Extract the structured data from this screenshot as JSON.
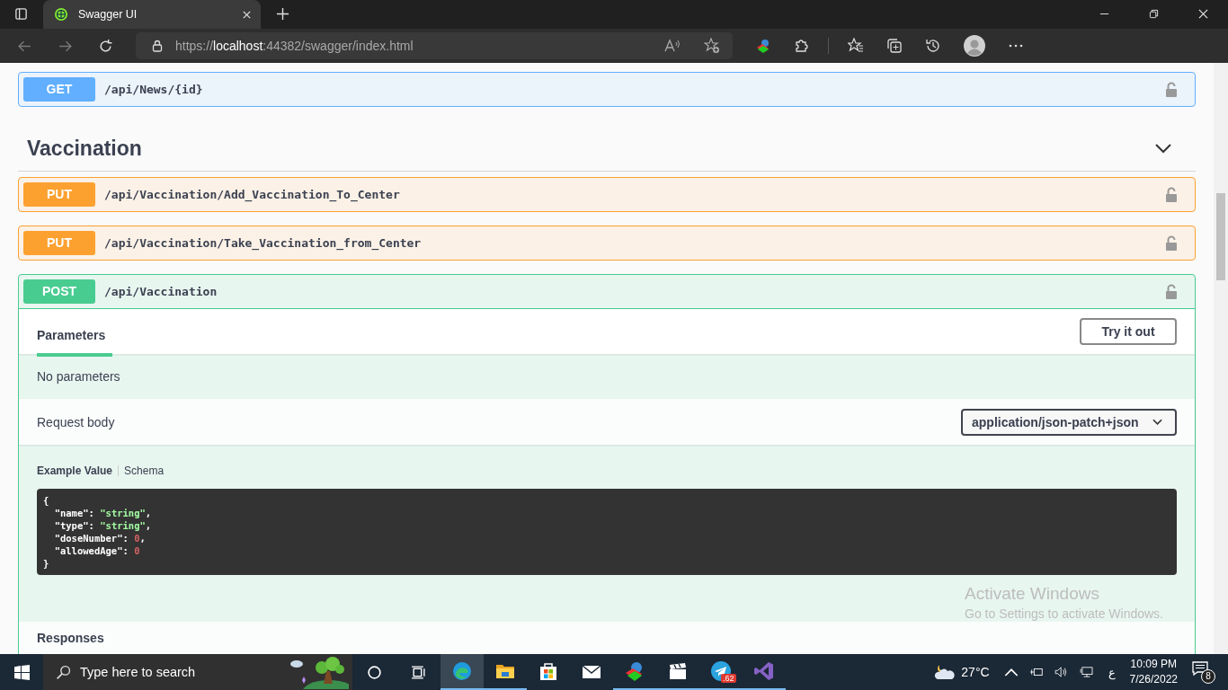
{
  "browser": {
    "tab": {
      "title": "Swagger UI",
      "selected": true
    },
    "address": {
      "scheme": "https://",
      "host": "localhost",
      "rest": ":44382/swagger/index.html"
    }
  },
  "top_operations": [
    {
      "method": "GET",
      "path": "/api/News/{id}",
      "expanded": false
    }
  ],
  "section": {
    "title": "Vaccination",
    "expanded": true
  },
  "operations": [
    {
      "method": "PUT",
      "path": "/api/Vaccination/Add_Vaccination_To_Center",
      "expanded": false
    },
    {
      "method": "PUT",
      "path": "/api/Vaccination/Take_Vaccination_from_Center",
      "expanded": false
    },
    {
      "method": "POST",
      "path": "/api/Vaccination",
      "expanded": true
    }
  ],
  "details": {
    "tab": {
      "label": "Parameters",
      "selected": true
    },
    "try_button": "Try it out",
    "no_params": "No parameters",
    "request_body_label": "Request body",
    "content_type": "application/json-patch+json",
    "example_tabs": [
      {
        "label": "Example Value",
        "selected": true
      },
      {
        "label": "Schema",
        "selected": false
      }
    ],
    "code": [
      {
        "tokens": [
          {
            "kind": "punct",
            "t": "{"
          }
        ]
      },
      {
        "tokens": [
          {
            "kind": "key",
            "t": "  \"name\""
          },
          {
            "kind": "punct",
            "t": ": "
          },
          {
            "kind": "string",
            "t": "\"string\""
          },
          {
            "kind": "punct",
            "t": ","
          }
        ]
      },
      {
        "tokens": [
          {
            "kind": "key",
            "t": "  \"type\""
          },
          {
            "kind": "punct",
            "t": ": "
          },
          {
            "kind": "string",
            "t": "\"string\""
          },
          {
            "kind": "punct",
            "t": ","
          }
        ]
      },
      {
        "tokens": [
          {
            "kind": "key",
            "t": "  \"doseNumber\""
          },
          {
            "kind": "punct",
            "t": ": "
          },
          {
            "kind": "number",
            "t": "0"
          },
          {
            "kind": "punct",
            "t": ","
          }
        ]
      },
      {
        "tokens": [
          {
            "kind": "key",
            "t": "  \"allowedAge\""
          },
          {
            "kind": "punct",
            "t": ": "
          },
          {
            "kind": "number",
            "t": "0"
          }
        ]
      },
      {
        "tokens": [
          {
            "kind": "punct",
            "t": "}"
          }
        ]
      }
    ],
    "responses_title": "Responses"
  },
  "os_notice": {
    "title": "Activate Windows",
    "text": "Go to Settings to activate Windows."
  },
  "taskbar": {
    "search_placeholder": "Type here to search",
    "apps": [
      {
        "kind": "edge",
        "running": true,
        "selected": true
      },
      {
        "kind": "folder",
        "running": true,
        "selected": false
      },
      {
        "kind": "store",
        "running": false,
        "selected": false
      },
      {
        "kind": "mail",
        "running": false,
        "selected": false
      },
      {
        "kind": "download",
        "running": true,
        "selected": false
      },
      {
        "kind": "clapper",
        "running": true,
        "selected": false
      },
      {
        "kind": "telegram",
        "running": true,
        "selected": false,
        "badge": ".62"
      },
      {
        "kind": "studio",
        "running": true,
        "selected": false
      }
    ],
    "temperature": "27°C",
    "language": "ع",
    "time": "10:09 PM",
    "date": "7/26/2022",
    "notifications": "8"
  }
}
